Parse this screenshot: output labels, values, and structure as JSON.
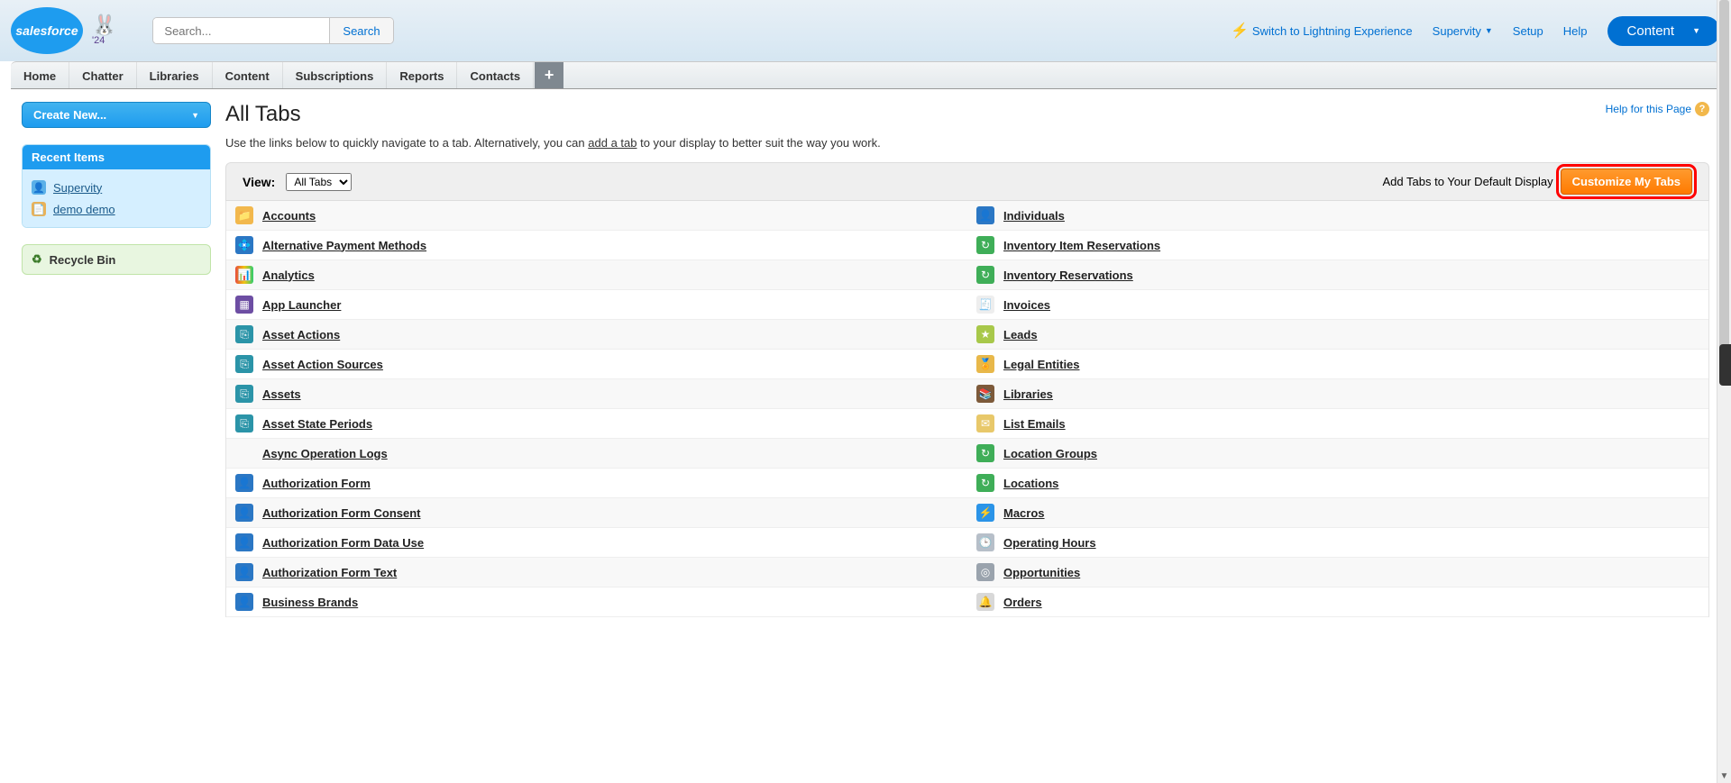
{
  "header": {
    "logo_text": "salesforce",
    "mascot_badge": "'24",
    "search_placeholder": "Search...",
    "search_button": "Search",
    "switch_link": "Switch to Lightning Experience",
    "user_menu": "Supervity",
    "setup_link": "Setup",
    "help_link": "Help",
    "app_menu": "Content"
  },
  "nav_tabs": [
    "Home",
    "Chatter",
    "Libraries",
    "Content",
    "Subscriptions",
    "Reports",
    "Contacts"
  ],
  "sidebar": {
    "create_new": "Create New...",
    "recent_header": "Recent Items",
    "recent": [
      {
        "label": "Supervity",
        "icon": "user"
      },
      {
        "label": "demo demo",
        "icon": "doc"
      }
    ],
    "recycle": "Recycle Bin"
  },
  "page": {
    "title": "All Tabs",
    "help_text": "Help for this Page",
    "sub_pre": "Use the links below to quickly navigate to a tab. Alternatively, you can ",
    "sub_link": "add a tab",
    "sub_post": " to your display to better suit the way you work.",
    "view_label": "View:",
    "view_value": "All Tabs",
    "add_default_text": "Add Tabs to Your Default Display",
    "customize_btn": "Customize My Tabs"
  },
  "tabs_left": [
    {
      "label": "Accounts",
      "ico": "c-folder",
      "g": "📁"
    },
    {
      "label": "Alternative Payment Methods",
      "ico": "c-blue",
      "g": "💠"
    },
    {
      "label": "Analytics",
      "ico": "c-chart",
      "g": "📊"
    },
    {
      "label": "App Launcher",
      "ico": "c-purple",
      "g": "▦"
    },
    {
      "label": "Asset Actions",
      "ico": "c-teal",
      "g": "⎘"
    },
    {
      "label": "Asset Action Sources",
      "ico": "c-teal",
      "g": "⎘"
    },
    {
      "label": "Assets",
      "ico": "c-teal",
      "g": "⎘"
    },
    {
      "label": "Asset State Periods",
      "ico": "c-teal",
      "g": "⎘"
    },
    {
      "label": "Async Operation Logs",
      "noicon": true
    },
    {
      "label": "Authorization Form",
      "ico": "c-blue",
      "g": "👤"
    },
    {
      "label": "Authorization Form Consent",
      "ico": "c-blue",
      "g": "👤"
    },
    {
      "label": "Authorization Form Data Use",
      "ico": "c-blue",
      "g": "👤"
    },
    {
      "label": "Authorization Form Text",
      "ico": "c-blue",
      "g": "👤"
    },
    {
      "label": "Business Brands",
      "ico": "c-blue",
      "g": "👤"
    }
  ],
  "tabs_right": [
    {
      "label": "Individuals",
      "ico": "c-blue",
      "g": "👤"
    },
    {
      "label": "Inventory Item Reservations",
      "ico": "c-green",
      "g": "↻"
    },
    {
      "label": "Inventory Reservations",
      "ico": "c-green",
      "g": "↻"
    },
    {
      "label": "Invoices",
      "ico": "c-white",
      "g": "🧾"
    },
    {
      "label": "Leads",
      "ico": "c-star",
      "g": "★"
    },
    {
      "label": "Legal Entities",
      "ico": "c-ribbon",
      "g": "🏅"
    },
    {
      "label": "Libraries",
      "ico": "c-books",
      "g": "📚"
    },
    {
      "label": "List Emails",
      "ico": "c-mail",
      "g": "✉"
    },
    {
      "label": "Location Groups",
      "ico": "c-green",
      "g": "↻"
    },
    {
      "label": "Locations",
      "ico": "c-green",
      "g": "↻"
    },
    {
      "label": "Macros",
      "ico": "c-flash",
      "g": "⚡"
    },
    {
      "label": "Operating Hours",
      "ico": "c-clock",
      "g": "🕒"
    },
    {
      "label": "Opportunities",
      "ico": "c-gray",
      "g": "◎"
    },
    {
      "label": "Orders",
      "ico": "c-bell",
      "g": "🔔"
    }
  ]
}
